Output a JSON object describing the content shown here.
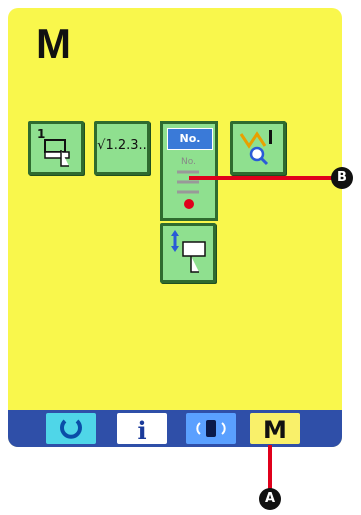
{
  "screen": {
    "title": "M"
  },
  "buttons": [
    {
      "name": "sewing-1-button",
      "label": "1"
    },
    {
      "name": "counter-button",
      "label": "√1.2.3.."
    },
    {
      "name": "no-cycle-button",
      "label": "No."
    },
    {
      "name": "pattern-check-button",
      "label": ""
    },
    {
      "name": "feed-button",
      "label": ""
    }
  ],
  "cycle_button": {
    "top_label": "No.",
    "lower_label": "No."
  },
  "footer": {
    "reset_label": "",
    "info_label": "i",
    "comm_label": "",
    "mode_label": "M"
  },
  "markers": {
    "a": "A",
    "b": "B"
  },
  "colors": {
    "panel": "#f9f74c",
    "button_green": "#8fe08f",
    "bar_blue": "#2f4fa8",
    "accent_red": "#e0001b"
  }
}
